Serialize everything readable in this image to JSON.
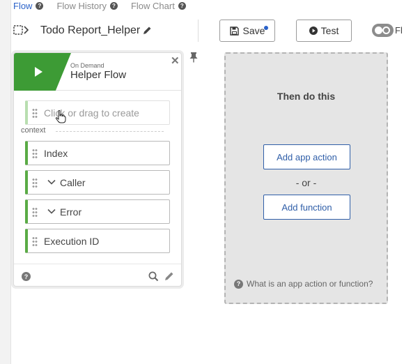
{
  "tabs": [
    {
      "label": "Flow",
      "active": true
    },
    {
      "label": "Flow History",
      "active": false
    },
    {
      "label": "Flow Chart",
      "active": false
    }
  ],
  "header": {
    "flow_name": "Todo Report_Helper",
    "save_label": "Save",
    "test_label": "Test",
    "toggle_label": "Fl",
    "toggle_on": false
  },
  "trigger_card": {
    "subtitle": "On Demand",
    "title": "Helper Flow",
    "create_placeholder": "Click or drag to create",
    "context_label": "context",
    "fields": [
      {
        "label": "Index",
        "expandable": false
      },
      {
        "label": "Caller",
        "expandable": true
      },
      {
        "label": "Error",
        "expandable": true
      },
      {
        "label": "Execution ID",
        "expandable": false
      }
    ]
  },
  "then_panel": {
    "title": "Then do this",
    "add_action_label": "Add app action",
    "or_label": "- or -",
    "add_function_label": "Add function",
    "help_text": "What is an app action or function?"
  },
  "colors": {
    "accent_blue": "#2a62c9",
    "trigger_green": "#3d9b35",
    "panel_gray": "#e5e5e5"
  }
}
